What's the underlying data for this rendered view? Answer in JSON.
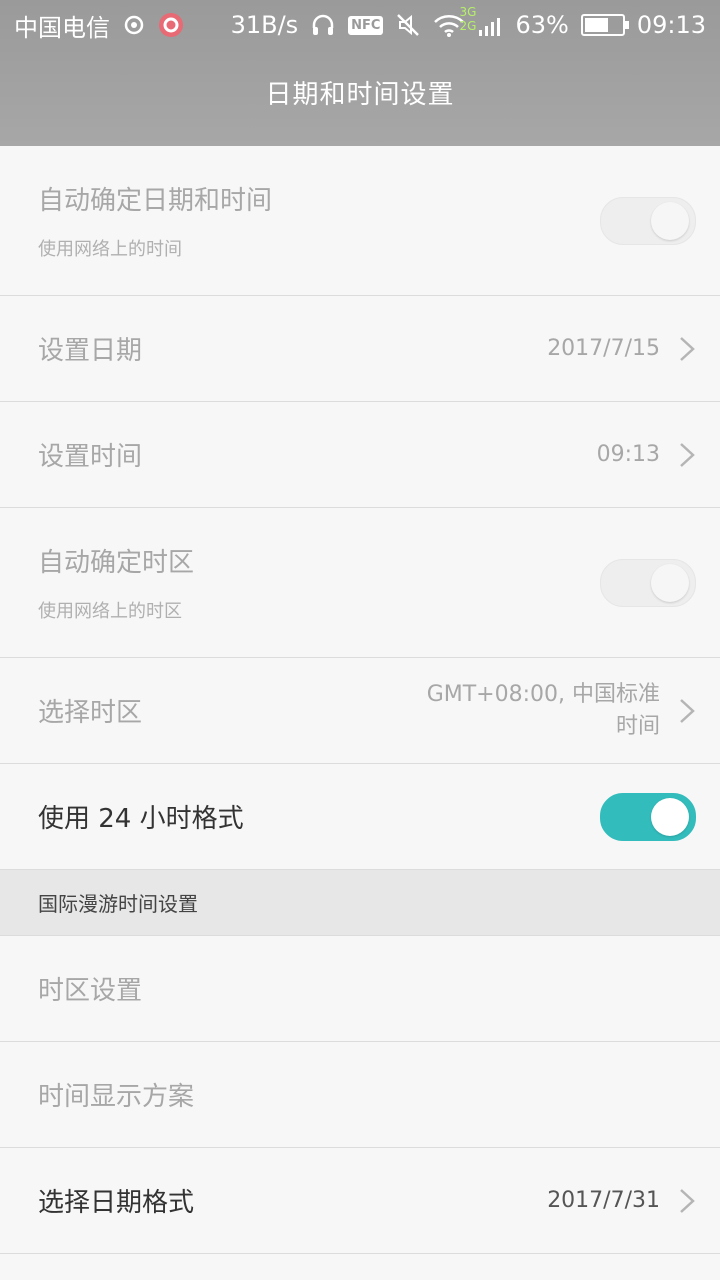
{
  "status_bar": {
    "carrier": "中国电信",
    "speed": "31B/s",
    "nfc": "NFC",
    "network_top": "3G",
    "network_bottom": "2G",
    "battery_percent": 63,
    "battery_text": "63%",
    "time": "09:13"
  },
  "header": {
    "title": "日期和时间设置"
  },
  "rows": [
    {
      "title": "自动确定日期和时间",
      "subtitle": "使用网络上的时间",
      "toggle_on": false
    },
    {
      "title": "设置日期",
      "value": "2017/7/15"
    },
    {
      "title": "设置时间",
      "value": "09:13"
    },
    {
      "title": "自动确定时区",
      "subtitle": "使用网络上的时区",
      "toggle_on": false
    },
    {
      "title": "选择时区",
      "value": "GMT+08:00, 中国标准时间"
    },
    {
      "title": "使用 24 小时格式",
      "toggle_on": true
    }
  ],
  "section": {
    "label": "国际漫游时间设置"
  },
  "roaming_rows": [
    {
      "title": "时区设置"
    },
    {
      "title": "时间显示方案"
    },
    {
      "title": "选择日期格式",
      "value": "2017/7/31"
    }
  ],
  "colors": {
    "accent": "#33bcbc",
    "header": "#a1a1a1"
  }
}
